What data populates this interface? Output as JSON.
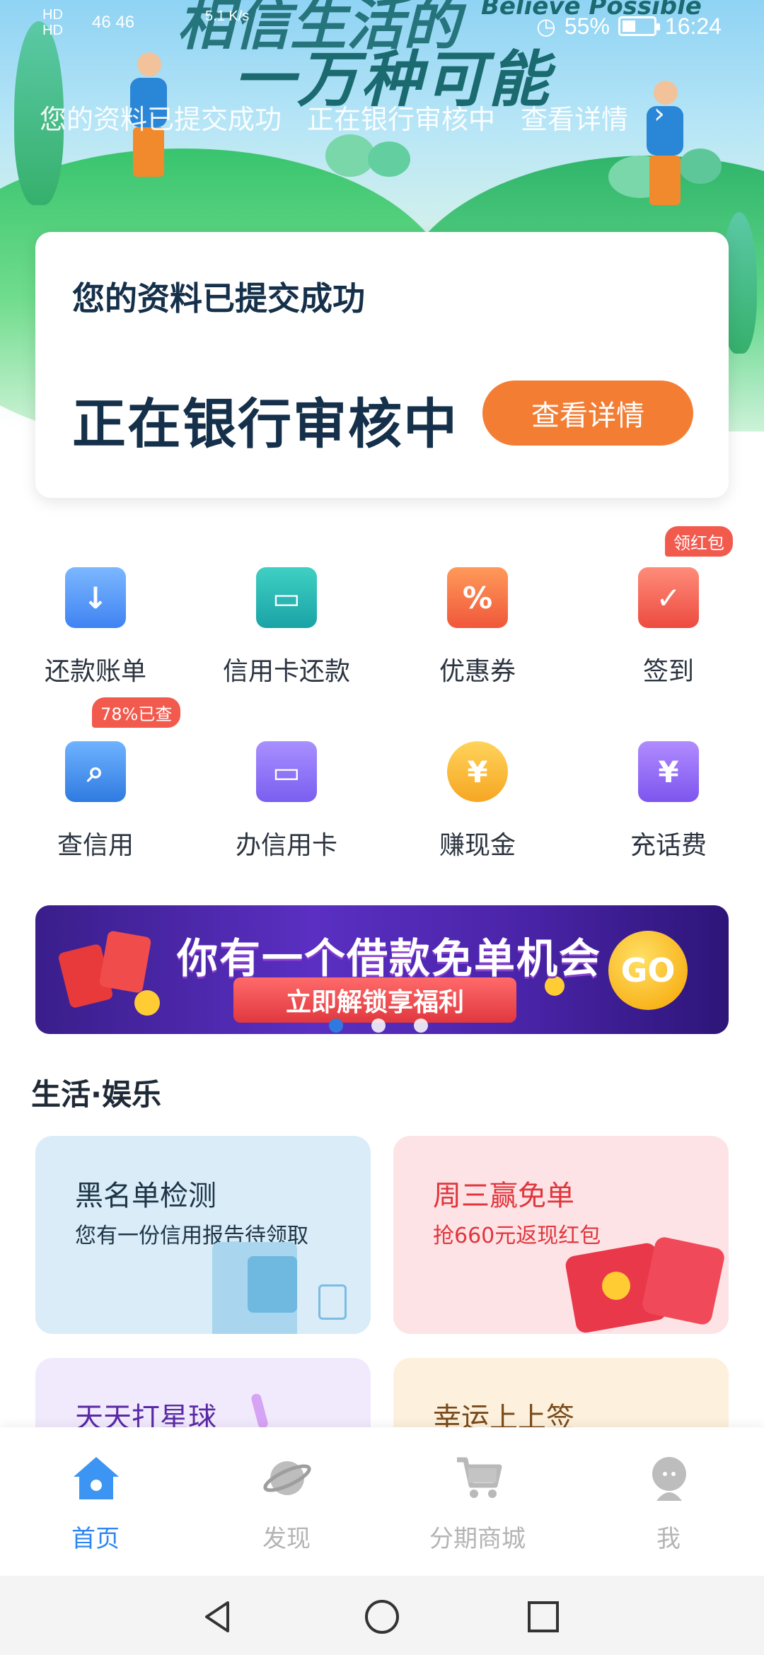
{
  "status_bar": {
    "hd1": "HD",
    "hd2": "HD",
    "network": "46 46",
    "speed": "5.1 K/s",
    "battery": "55%",
    "time": "16:24"
  },
  "hero": {
    "slogan_top": "相信生活的",
    "slogan_en": "Believe Possible",
    "slogan": "一万种可能",
    "notice": [
      "您的资料已提交成功",
      "正在银行审核中",
      "查看详情"
    ]
  },
  "status_card": {
    "title": "您的资料已提交成功",
    "status": "正在银行审核中",
    "button": "查看详情"
  },
  "services": [
    {
      "label": "还款账单",
      "icon": "bill-download-icon"
    },
    {
      "label": "信用卡还款",
      "icon": "credit-card-repay-icon"
    },
    {
      "label": "优惠券",
      "icon": "coupon-icon"
    },
    {
      "label": "签到",
      "icon": "checkin-calendar-icon",
      "badge": "领红包"
    },
    {
      "label": "查信用",
      "icon": "credit-search-icon",
      "badge": "78%已查"
    },
    {
      "label": "办信用卡",
      "icon": "apply-card-icon"
    },
    {
      "label": "赚现金",
      "icon": "piggy-bank-icon"
    },
    {
      "label": "充话费",
      "icon": "phone-topup-icon"
    }
  ],
  "banner": {
    "title": "你有一个借款免单机会",
    "subtitle": "立即解锁享福利",
    "go": "GO",
    "active_index": 0,
    "slides": 3
  },
  "section": {
    "title": "生活·娱乐",
    "cards": [
      {
        "title": "黑名单检测",
        "subtitle": "您有一份信用报告待领取"
      },
      {
        "title": "周三赢免单",
        "subtitle": "抢660元返现红包"
      },
      {
        "title": "天天打星球",
        "subtitle": ""
      },
      {
        "title": "幸运上上签",
        "subtitle": ""
      }
    ]
  },
  "bottom_nav": [
    {
      "label": "首页",
      "icon": "home-icon",
      "active": true
    },
    {
      "label": "发现",
      "icon": "planet-icon",
      "active": false
    },
    {
      "label": "分期商城",
      "icon": "cart-icon",
      "active": false
    },
    {
      "label": "我",
      "icon": "profile-icon",
      "active": false
    }
  ],
  "colors": {
    "accent": "#f47d34",
    "primary_blue": "#2f86f0",
    "badge_red": "#f25a4e",
    "text_dark": "#15304a"
  }
}
